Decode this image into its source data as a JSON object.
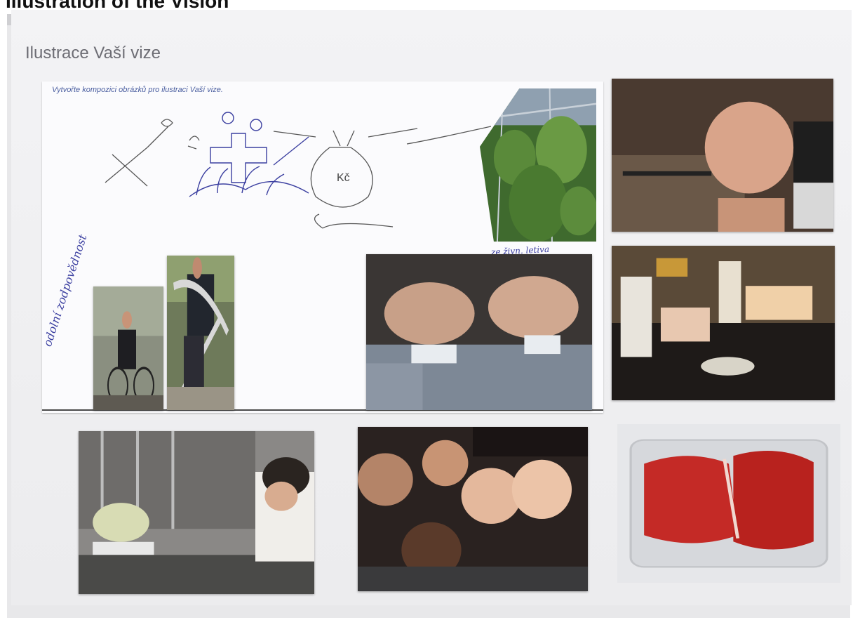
{
  "header": {
    "title": "Illustration of the Vision"
  },
  "poster": {
    "title": "Ilustrace Vaší vize",
    "instruction": "Vytvořte kompozici obrázků pro ilustraci Vaší vize.",
    "sketch_labels": {
      "currency": "Kč",
      "left_note": "odolní\nzodpovědnost",
      "center_caption": "ze živn. letiva"
    }
  },
  "photos": [
    {
      "name": "greenhouse-plants-photo"
    },
    {
      "name": "robot-head-photo"
    },
    {
      "name": "cyclist-photo"
    },
    {
      "name": "exercise-machine-photo"
    },
    {
      "name": "surgery-photo"
    },
    {
      "name": "fridge-food-photo"
    },
    {
      "name": "laboratory-photo"
    },
    {
      "name": "friends-group-photo"
    },
    {
      "name": "raw-meat-package-photo"
    }
  ],
  "colors": {
    "ink_blue": "#3b3fa0",
    "title_gray": "#6d6d74"
  }
}
